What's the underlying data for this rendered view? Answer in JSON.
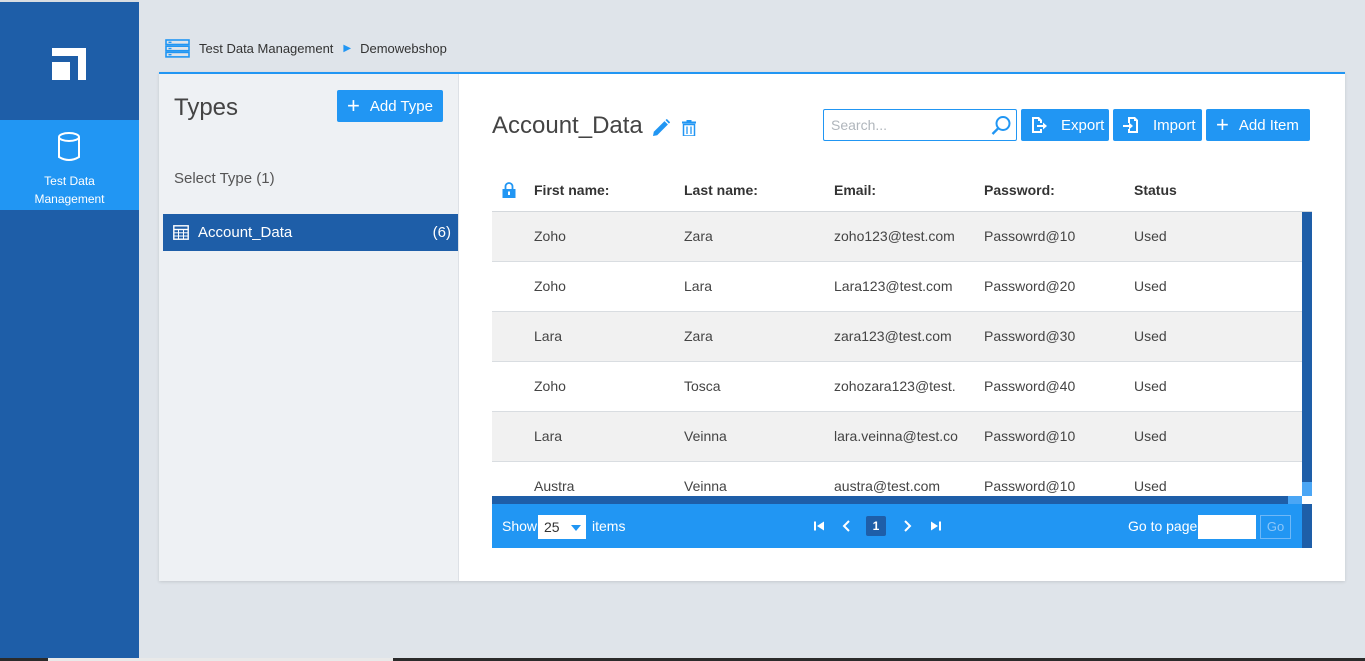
{
  "nav": {
    "logo_icon": "app-logo-icon",
    "active_item": {
      "icon": "database-icon",
      "label_line1": "Test Data",
      "label_line2": "Management"
    }
  },
  "breadcrumb": {
    "icon": "server-icon",
    "items": [
      "Test Data Management",
      "Demowebshop"
    ],
    "separator_icon": "triangle-right-icon"
  },
  "types_panel": {
    "title": "Types",
    "add_type_label": "Add Type",
    "select_type_label": "Select Type (1)",
    "items": [
      {
        "icon": "table-icon",
        "label": "Account_Data",
        "count": "(6)"
      }
    ]
  },
  "content": {
    "title": "Account_Data",
    "search_placeholder": "Search...",
    "export_label": "Export",
    "import_label": "Import",
    "add_item_label": "Add Item",
    "columns": [
      "First name:",
      "Last name:",
      "Email:",
      "Password:",
      "Status"
    ],
    "rows": [
      [
        "Zoho",
        "Zara",
        "zoho123@test.com",
        "Passowrd@10",
        "Used"
      ],
      [
        "Zoho",
        "Lara",
        "Lara123@test.com",
        "Password@20",
        "Used"
      ],
      [
        "Lara",
        "Zara",
        "zara123@test.com",
        "Password@30",
        "Used"
      ],
      [
        "Zoho",
        "Tosca",
        "zohozara123@test.",
        "Password@40",
        "Used"
      ],
      [
        "Lara",
        "Veinna",
        "lara.veinna@test.co",
        "Password@10",
        "Used"
      ],
      [
        "Austra",
        "Veinna",
        "austra@test.com",
        "Password@10",
        "Used"
      ]
    ]
  },
  "pager": {
    "show_label": "Show",
    "page_size": "25",
    "items_label": "items",
    "current_page": "1",
    "goto_label": "Go to page",
    "go_label": "Go"
  },
  "colors": {
    "primary": "#2196f3",
    "dark": "#1e5ea8",
    "background": "#dfe4ea"
  }
}
